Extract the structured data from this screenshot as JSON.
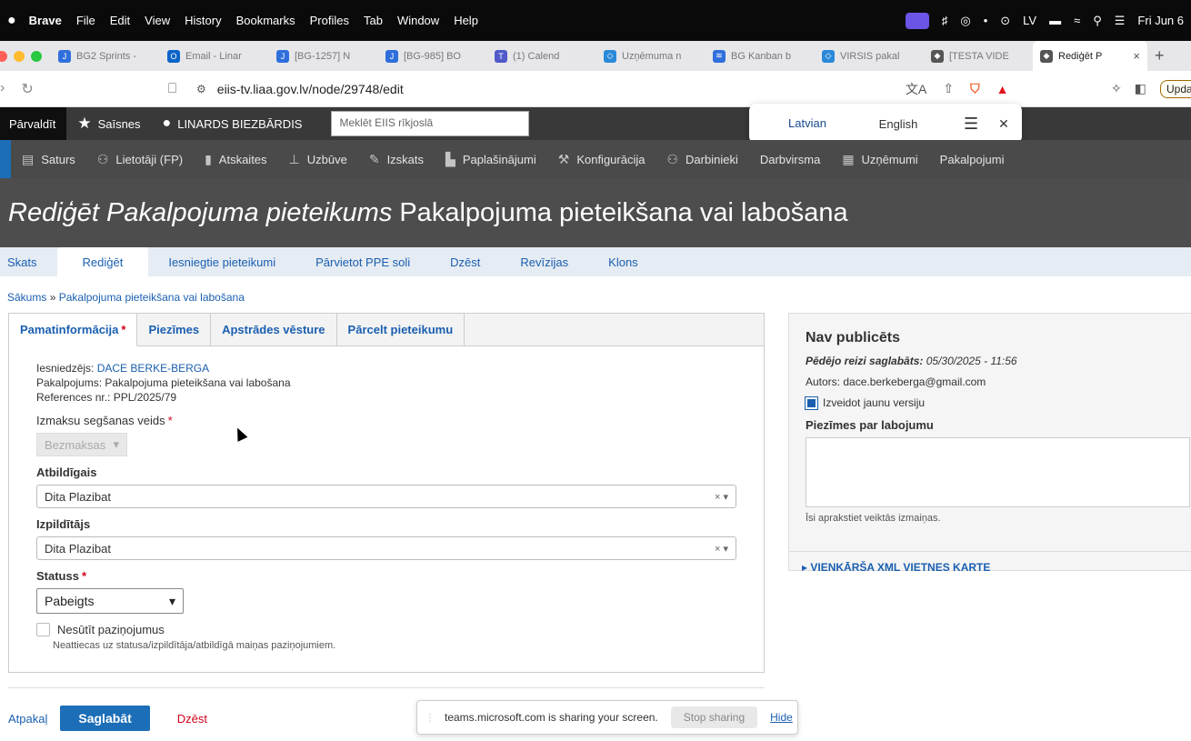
{
  "menubar": {
    "apple": "",
    "app": "Brave",
    "items": [
      "File",
      "Edit",
      "View",
      "History",
      "Bookmarks",
      "Profiles",
      "Tab",
      "Window",
      "Help"
    ],
    "clock": "Fri Jun 6"
  },
  "tabs": [
    {
      "label": "BG2 Sprints -",
      "color": "#2f6fdb",
      "glyph": "J"
    },
    {
      "label": "Email - Linar",
      "color": "#0a64c8",
      "glyph": "O"
    },
    {
      "label": "[BG-1257] N",
      "color": "#2f6fdb",
      "glyph": "J"
    },
    {
      "label": "[BG-985] BO",
      "color": "#2f6fdb",
      "glyph": "J"
    },
    {
      "label": "(1) Calend",
      "color": "#5059c9",
      "glyph": "T"
    },
    {
      "label": "Uzņēmuma n",
      "color": "#2a89d8",
      "glyph": "◇"
    },
    {
      "label": "BG Kanban b",
      "color": "#2f6fdb",
      "glyph": "≋"
    },
    {
      "label": "VIRSIS pakal",
      "color": "#2a89d8",
      "glyph": "◇"
    },
    {
      "label": "[TESTA VIDE",
      "color": "#555555",
      "glyph": "◆"
    },
    {
      "label": "Rediģēt P",
      "color": "#555555",
      "glyph": "◆"
    }
  ],
  "address": {
    "url": "eiis-tv.liaa.gov.lv/node/29748/edit",
    "update_label": "Upda"
  },
  "toolbar1": {
    "manage": "Pārvaldīt",
    "shortcuts": "Saīsnes",
    "user": "LINARDS BIEZBĀRDIS",
    "search_placeholder": "Meklēt EIIS rīkjoslā"
  },
  "lang_popup": {
    "lang1": "Latvian",
    "lang2": "English"
  },
  "toolbar2": {
    "items": [
      "Saturs",
      "Lietotāji (FP)",
      "Atskaites",
      "Uzbūve",
      "Izskats",
      "Paplašinājumi",
      "Konfigurācija",
      "Darbinieki",
      "Darbvirsma",
      "Uzņēmumi",
      "Pakalpojumi"
    ]
  },
  "page": {
    "title_italic": "Rediģēt Pakalpojuma pieteikums",
    "title_rest": "Pakalpojuma pieteikšana vai labošana"
  },
  "primary_tabs": [
    "Skats",
    "Rediģēt",
    "Iesniegtie pieteikumi",
    "Pārvietot PPE soli",
    "Dzēst",
    "Revīzijas",
    "Klons"
  ],
  "breadcrumb": {
    "home": "Sākums",
    "sep": "»",
    "current": "Pakalpojuma pieteikšana vai labošana"
  },
  "vtabs": {
    "items": [
      "Pamatinformācija",
      "Piezīmes",
      "Apstrādes vēsture",
      "Pārcelt pieteikumu"
    ],
    "required_mark": "*"
  },
  "form": {
    "submitter_label": "Iesniedzējs:",
    "submitter_name": "DACE BERKE-BERGA",
    "service_line": "Pakalpojums: Pakalpojuma pieteikšana vai labošana",
    "reference_line": "References nr.: PPL/2025/79",
    "payment_label": "Izmaksu segšanas veids",
    "payment_value": "Bezmaksas",
    "responsible_label": "Atbildīgais",
    "responsible_value": "Dita Plazibat",
    "executor_label": "Izpildītājs",
    "executor_value": "Dita Plazibat",
    "status_label": "Statuss",
    "status_value": "Pabeigts",
    "nonotify_label": "Nesūtīt paziņojumus",
    "nonotify_desc": "Neattiecas uz statusa/izpildītāja/atbildīgā maiņas paziņojumiem.",
    "clear_glyph": "×",
    "arrow_glyph": "▾"
  },
  "rpanel": {
    "title": "Nav publicēts",
    "saved_label": "Pēdējo reizi saglabāts:",
    "saved_value": "05/30/2025 - 11:56",
    "author": "Autors: dace.berkeberga@gmail.com",
    "new_version": "Izveidot jaunu versiju",
    "notes_label": "Piezīmes par labojumu",
    "notes_help": "Īsi aprakstiet veiktās izmaiņas.",
    "sitemap": "▸ VIENKĀRŠA XML VIETNES KARTE"
  },
  "actions": {
    "back": "Atpakaļ",
    "save": "Saglabāt",
    "delete": "Dzēst"
  },
  "share": {
    "text": "teams.microsoft.com is sharing your screen.",
    "stop": "Stop sharing",
    "hide": "Hide"
  }
}
